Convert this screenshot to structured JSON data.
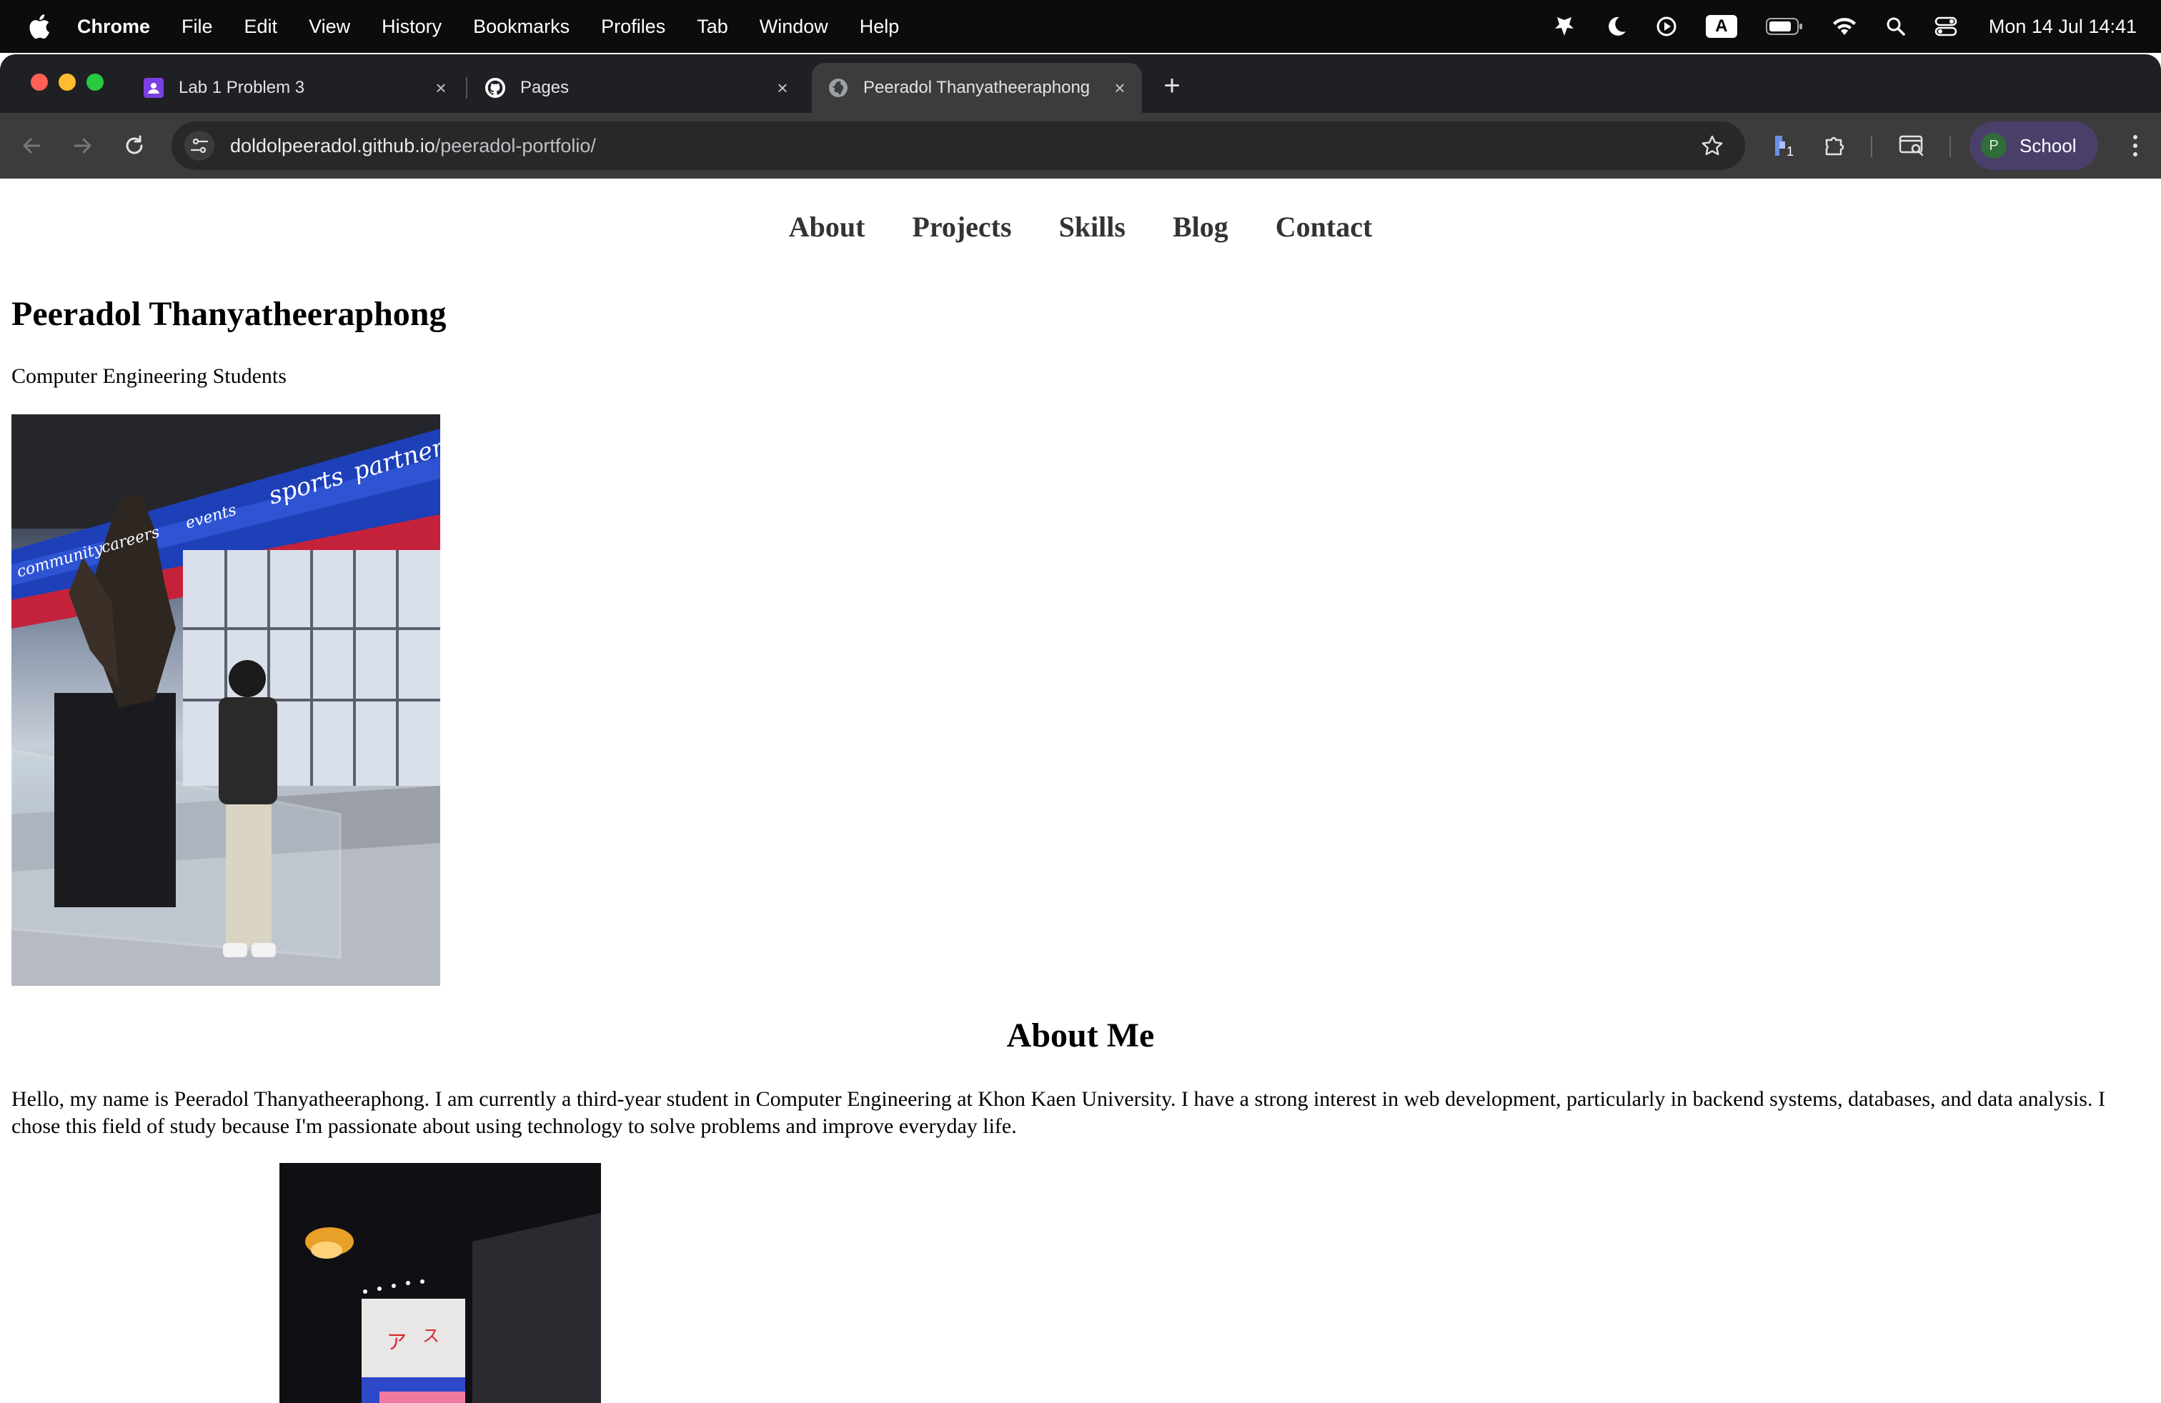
{
  "menubar": {
    "app_name": "Chrome",
    "items": [
      "File",
      "Edit",
      "View",
      "History",
      "Bookmarks",
      "Profiles",
      "Tab",
      "Window",
      "Help"
    ],
    "input_source": "A",
    "clock": "Mon 14 Jul  14:41"
  },
  "tabs": [
    {
      "title": "Lab 1 Problem 3",
      "favicon": "classroom-icon",
      "active": false
    },
    {
      "title": "Pages",
      "favicon": "github-icon",
      "active": false
    },
    {
      "title": "Peeradol Thanyatheeraphong",
      "favicon": "globe-icon",
      "active": true
    }
  ],
  "omnibox": {
    "host": "doldolpeeradol.github.io",
    "path": "/peeradol-portfolio/"
  },
  "extensions_badge": "1",
  "profile": {
    "initial": "P",
    "label": "School"
  },
  "page": {
    "nav": [
      "About",
      "Projects",
      "Skills",
      "Blog",
      "Contact"
    ],
    "name": "Peeradol Thanyatheeraphong",
    "subtitle": "Computer Engineering Students",
    "about_heading": "About Me",
    "about_text": "Hello, my name is Peeradol Thanyatheeraphong. I am currently a third-year student in Computer Engineering at Khon Kaen University. I have a strong interest in web development, particularly in backend systems, databases, and data analysis. I chose this field of study because I'm passionate about using technology to solve problems and improve everyday life.",
    "photo1_banner_words": [
      "community",
      "careers",
      "events",
      "sports",
      "partners"
    ]
  },
  "colors": {
    "menubar_bg": "#0b0c0e",
    "tabstrip_bg": "#1f2023",
    "toolbar_bg": "#3c3c3c",
    "profile_chip": "#4a3f6b",
    "nav_link": "#333333"
  }
}
